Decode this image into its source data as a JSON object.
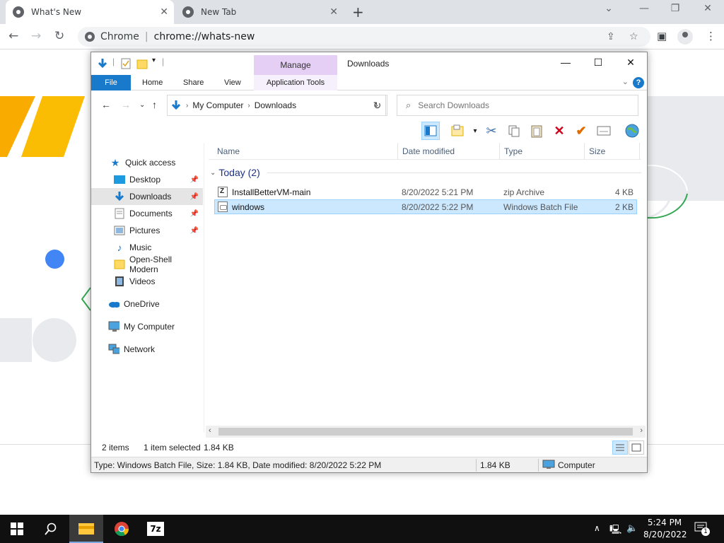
{
  "browser": {
    "tabs": [
      {
        "title": "What's New",
        "active": true
      },
      {
        "title": "New Tab",
        "active": false
      }
    ],
    "omnibox": {
      "site": "Chrome",
      "url": "chrome://whats-new"
    }
  },
  "explorer": {
    "title": "Downloads",
    "ribbon": {
      "contextual_group": "Manage",
      "tabs": [
        "File",
        "Home",
        "Share",
        "View",
        "Application Tools"
      ]
    },
    "address": {
      "crumbs": [
        "My Computer",
        "Downloads"
      ]
    },
    "search": {
      "placeholder": "Search Downloads"
    },
    "nav": {
      "quick_access": "Quick access",
      "items": [
        "Desktop",
        "Downloads",
        "Documents",
        "Pictures",
        "Music",
        "Open-Shell Modern",
        "Videos"
      ],
      "onedrive": "OneDrive",
      "computer": "My Computer",
      "network": "Network"
    },
    "columns": [
      "Name",
      "Date modified",
      "Type",
      "Size"
    ],
    "group": "Today (2)",
    "files": [
      {
        "name": "InstallBetterVM-main",
        "date": "8/20/2022 5:21 PM",
        "type": "zip Archive",
        "size": "4 KB",
        "selected": false
      },
      {
        "name": "windows",
        "date": "8/20/2022 5:22 PM",
        "type": "Windows Batch File",
        "size": "2 KB",
        "selected": true
      }
    ],
    "status": {
      "items": "2 items",
      "selected": "1 item selected",
      "sel_size": "1.84 KB"
    },
    "details": {
      "text": "Type: Windows Batch File, Size: 1.84 KB, Date modified: 8/20/2022 5:22 PM",
      "size": "1.84 KB",
      "location": "Computer"
    }
  },
  "taskbar": {
    "time": "5:24 PM",
    "date": "8/20/2022",
    "notifications": "1",
    "apps": [
      "file-explorer",
      "chrome",
      "7-zip"
    ]
  }
}
